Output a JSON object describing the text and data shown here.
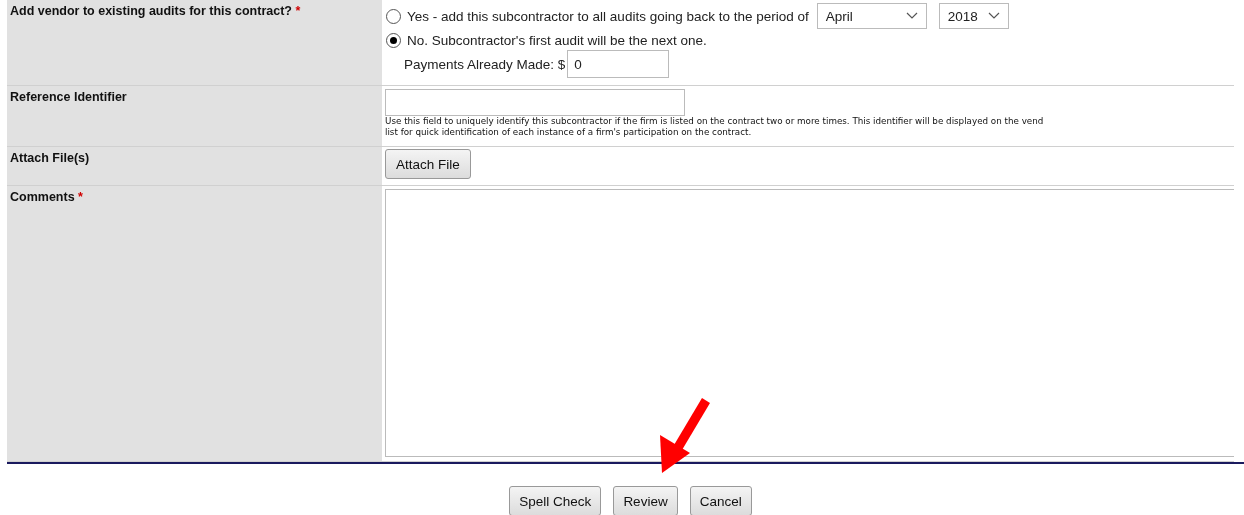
{
  "rows": [
    {
      "kind": "audit",
      "label": "Add vendor to existing audits for this contract?",
      "required_mark": "*",
      "options": [
        {
          "label": "Yes - add this subcontractor to all audits going back to the period of",
          "selected": false
        },
        {
          "label": "No. Subcontractor's first audit will be the next one.",
          "selected": true
        }
      ],
      "month": "April",
      "year": "2018",
      "payments_label": "Payments Already Made: $",
      "payments_value": "0"
    },
    {
      "kind": "text",
      "label": "Reference Identifier",
      "help": [
        "Use this field to uniquely identify this subcontractor if the firm is listed on the contract two or more times. This identifier will be displayed on the vend",
        "list for quick identification of each instance of a firm's participation on the contract."
      ]
    },
    {
      "kind": "file",
      "label": "Attach File(s)",
      "button": "Attach File"
    },
    {
      "kind": "textarea",
      "label": "Comments",
      "required_mark": "*"
    }
  ],
  "buttons": [
    "Spell Check",
    "Review",
    "Cancel"
  ]
}
